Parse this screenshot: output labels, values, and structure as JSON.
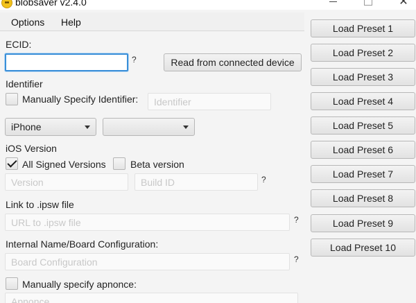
{
  "window": {
    "title": "blobsaver v2.4.0",
    "icon": "blobsaver-app-icon",
    "minimize_icon": "minimize-icon",
    "maximize_icon": "maximize-icon",
    "close_icon": "close-icon",
    "close_glyph": "✕"
  },
  "menu": {
    "options": "Options",
    "help": "Help"
  },
  "ecid": {
    "label": "ECID:",
    "value": "",
    "help": "?",
    "read_button": "Read from connected device"
  },
  "identifier": {
    "section_label": "Identifier",
    "manual_label": "Manually Specify Identifier:",
    "manual_checked": false,
    "placeholder": "Identifier"
  },
  "device": {
    "type_selected": "iPhone",
    "model_selected": ""
  },
  "ios": {
    "section_label": "iOS Version",
    "all_signed_label": "All Signed Versions",
    "all_signed_checked": true,
    "beta_label": "Beta version",
    "beta_checked": false,
    "version_placeholder": "Version",
    "build_placeholder": "Build ID",
    "help": "?"
  },
  "ipsw": {
    "label": "Link to .ipsw file",
    "placeholder": "URL to .ipsw file",
    "help": "?"
  },
  "board": {
    "label": "Internal Name/Board Configuration:",
    "placeholder": "Board Configuration",
    "help": "?"
  },
  "apnonce": {
    "label": "Manually specify apnonce:",
    "checked": false,
    "placeholder": "Apnonce"
  },
  "presets": [
    "Load Preset 1",
    "Load Preset 2",
    "Load Preset 3",
    "Load Preset 4",
    "Load Preset 5",
    "Load Preset 6",
    "Load Preset 7",
    "Load Preset 8",
    "Load Preset 9",
    "Load Preset 10"
  ]
}
